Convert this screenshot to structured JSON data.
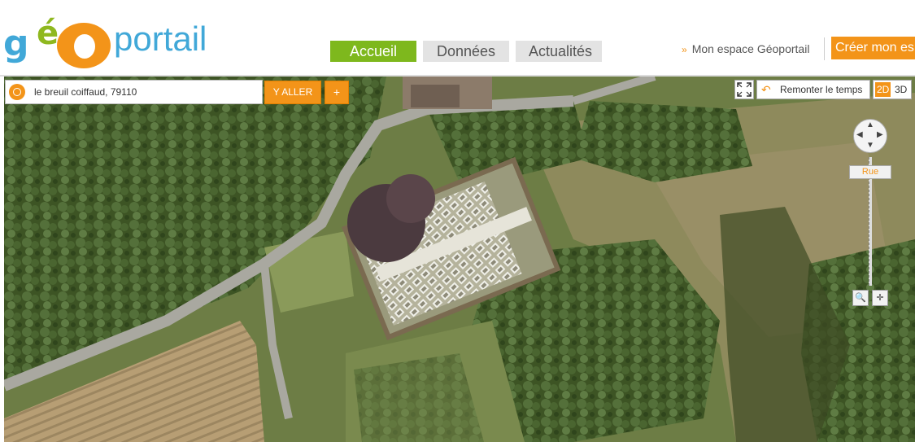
{
  "header": {
    "logo_letters": {
      "g": "g",
      "e": "é",
      "o": "O",
      "rest": "portail"
    },
    "tabs": [
      {
        "label": "Accueil",
        "active": true
      },
      {
        "label": "Données",
        "active": false
      },
      {
        "label": "Actualités",
        "active": false
      }
    ],
    "espace_label": "Mon espace Géoportail",
    "creer_label": "Créer mon es"
  },
  "search": {
    "value": "le breuil coiffaud, 79110",
    "go_label": "Y ALLER",
    "plus_label": "+"
  },
  "map_controls": {
    "fullscreen_icon": "fullscreen-icon",
    "remonter_label": "Remonter le temps",
    "mode_2d": "2D",
    "mode_3d": "3D",
    "zoom_level_label": "Rue",
    "zoom_search_icon": "magnifier-icon",
    "zoom_target_icon": "crosshair-icon"
  },
  "colors": {
    "brand_orange": "#f39419",
    "brand_green": "#7eb81d",
    "brand_blue": "#41a8d8"
  }
}
